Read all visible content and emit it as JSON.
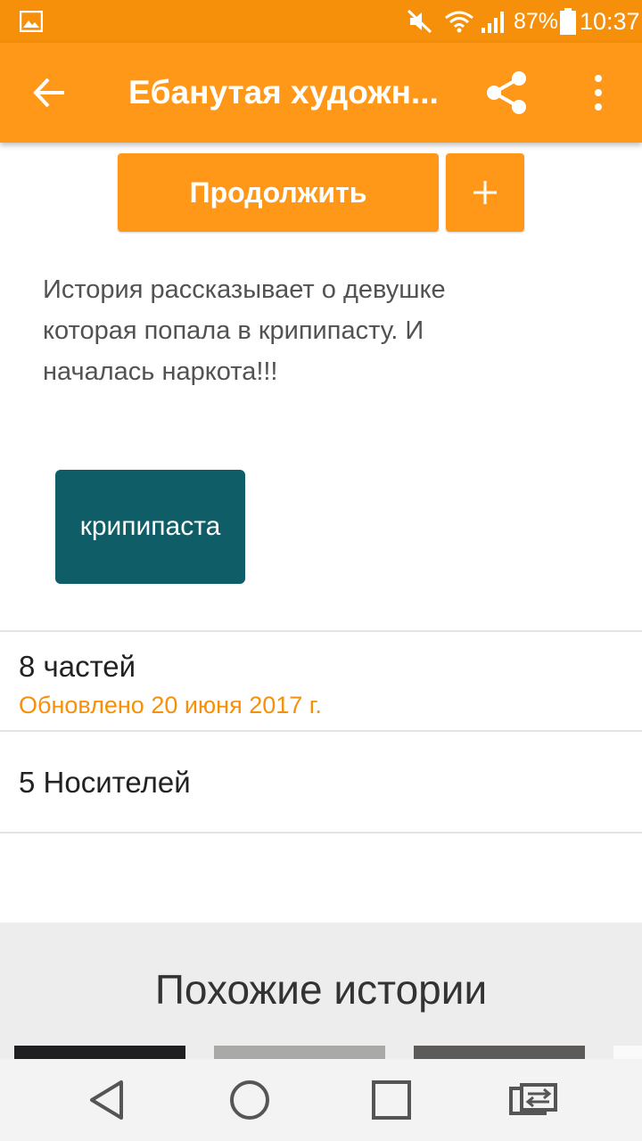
{
  "status_bar": {
    "battery_percent": "87%",
    "time": "10:37",
    "icons": [
      "gallery-icon",
      "mute-icon",
      "wifi-icon",
      "signal-icon",
      "battery-icon"
    ]
  },
  "app_bar": {
    "title": "Ебанутая художн...",
    "icons": [
      "back-arrow-icon",
      "share-icon",
      "more-vert-icon"
    ]
  },
  "actions": {
    "continue_label": "Продолжить",
    "add_icon": "plus-icon"
  },
  "story": {
    "description": "История рассказывает о девушке которая попала в крипипасту. И началась наркота!!!",
    "tag": "крипипаста",
    "parts": "8 частей",
    "updated": "Обновлено 20 июня 2017 г.",
    "readers": "5 Носителей"
  },
  "similar": {
    "heading": "Похожие истории"
  },
  "nav_bar": {
    "icons": [
      "back-triangle-icon",
      "home-circle-icon",
      "recents-square-icon",
      "switch-app-icon"
    ]
  },
  "colors": {
    "status_bar": "#f6900a",
    "app_bar": "#ff9819",
    "tag_background": "#0e5d67",
    "accent_text": "#f6900a"
  }
}
